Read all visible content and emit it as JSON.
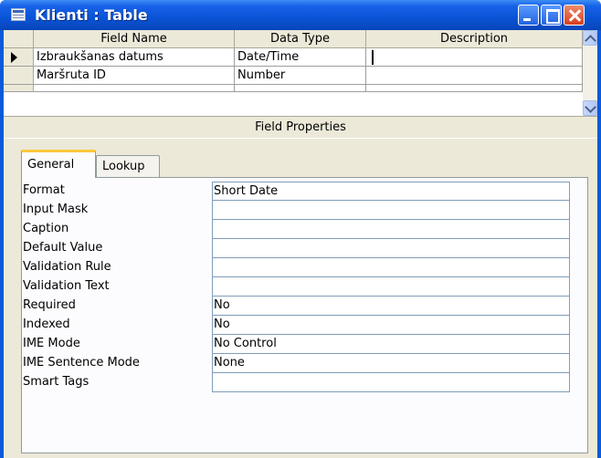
{
  "window": {
    "title": "Klienti : Table"
  },
  "grid": {
    "headers": [
      "Field Name",
      "Data Type",
      "Description"
    ],
    "rows": [
      {
        "field_name": "Izbraukšanas datums",
        "data_type": "Date/Time",
        "description": ""
      },
      {
        "field_name": "Maršruta ID",
        "data_type": "Number",
        "description": ""
      }
    ]
  },
  "field_properties": {
    "label": "Field Properties",
    "tabs": [
      "General",
      "Lookup"
    ],
    "active_tab": "General",
    "properties": [
      {
        "name": "Format",
        "value": "Short Date"
      },
      {
        "name": "Input Mask",
        "value": ""
      },
      {
        "name": "Caption",
        "value": ""
      },
      {
        "name": "Default Value",
        "value": ""
      },
      {
        "name": "Validation Rule",
        "value": ""
      },
      {
        "name": "Validation Text",
        "value": ""
      },
      {
        "name": "Required",
        "value": "No"
      },
      {
        "name": "Indexed",
        "value": "No"
      },
      {
        "name": "IME Mode",
        "value": "No Control"
      },
      {
        "name": "IME Sentence Mode",
        "value": "None"
      },
      {
        "name": "Smart Tags",
        "value": ""
      }
    ]
  },
  "colors": {
    "titlebar": "#0a53d6",
    "close_button": "#d6401c",
    "dialog_bg": "#ece9d8",
    "active_tab_accent": "#ffc83c"
  }
}
